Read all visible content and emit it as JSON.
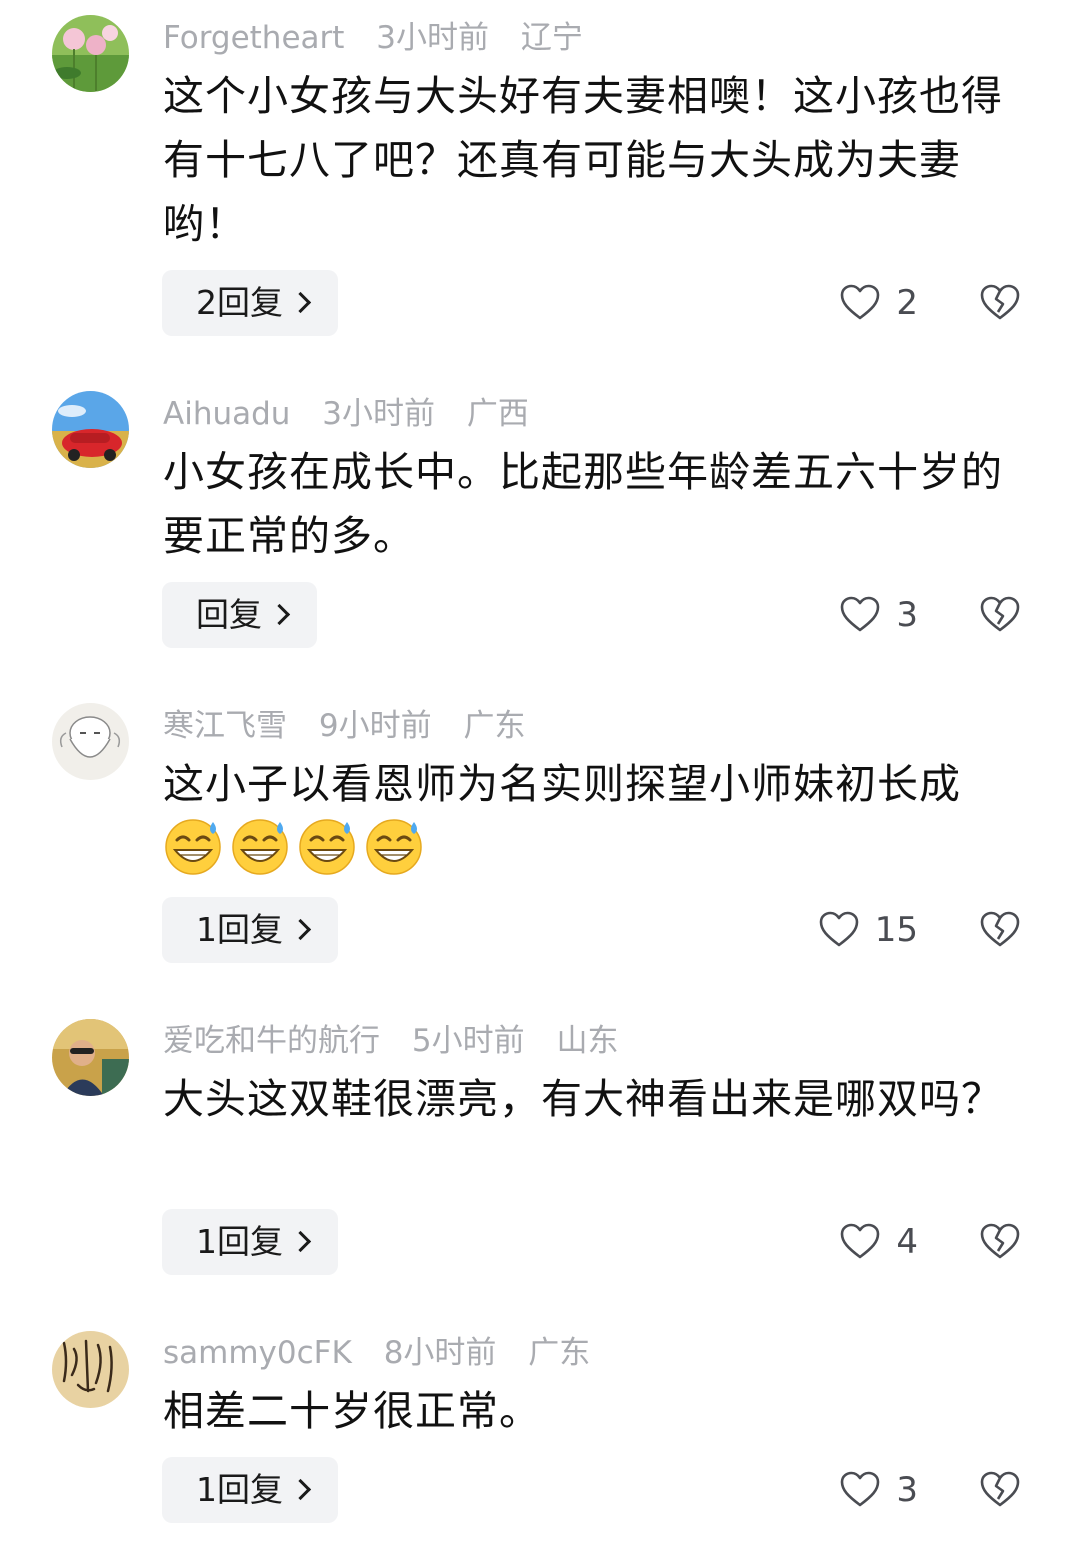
{
  "comments": [
    {
      "username": "Forgetheart",
      "time": "3小时前",
      "location": "辽宁",
      "avatar": "lotus-flowers-avatar",
      "text": "这个小女孩与大头好有夫妻相噢！这小孩也得有十七八了吧？还真有可能与大头成为夫妻哟！",
      "reply_label": "2回复",
      "likes": "2"
    },
    {
      "username": "Aihuadu",
      "time": "3小时前",
      "location": "广西",
      "avatar": "red-car-avatar",
      "text": "小女孩在成长中。比起那些年龄差五六十岁的要正常的多。",
      "reply_label": "回复",
      "likes": "3"
    },
    {
      "username": "寒江飞雪",
      "time": "9小时前",
      "location": "广东",
      "avatar": "old-man-sketch-avatar",
      "text": "这小子以看恩师为名实则探望小师妹初长成",
      "emojis": [
        "grin-sweat-emoji",
        "grin-sweat-emoji",
        "grin-sweat-emoji",
        "grin-sweat-emoji"
      ],
      "reply_label": "1回复",
      "likes": "15"
    },
    {
      "username": "爱吃和牛的航行",
      "time": "5小时前",
      "location": "山东",
      "avatar": "man-portrait-avatar",
      "text": "大头这双鞋很漂亮，有大神看出来是哪双吗？",
      "reply_label": "1回复",
      "likes": "4"
    },
    {
      "username": "sammy0cFK",
      "time": "8小时前",
      "location": "广东",
      "avatar": "calligraphy-avatar",
      "text": "相差二十岁很正常。",
      "reply_label": "1回复",
      "likes": "3"
    }
  ],
  "colors": {
    "meta_text": "#a9abb0",
    "body_text": "#111111",
    "reply_bg": "#f2f3f5",
    "icon_stroke": "#4a4c52"
  }
}
